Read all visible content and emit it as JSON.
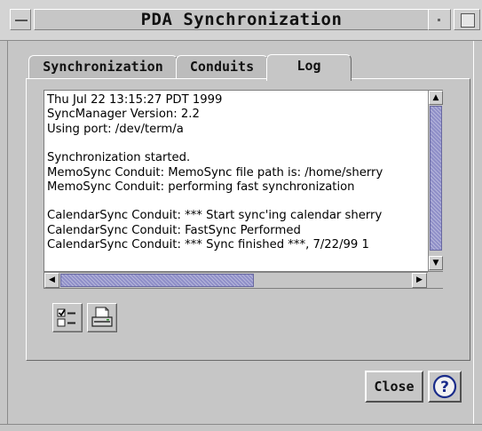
{
  "window": {
    "title": "PDA Synchronization"
  },
  "tabs": [
    {
      "label": "Synchronization",
      "selected": false
    },
    {
      "label": "Conduits",
      "selected": false
    },
    {
      "label": "Log",
      "selected": true
    }
  ],
  "log": {
    "lines": [
      "Thu Jul 22 13:15:27 PDT 1999",
      "SyncManager Version: 2.2",
      "Using port: /dev/term/a",
      "",
      "Synchronization started.",
      "MemoSync Conduit: MemoSync file path is: /home/sherry",
      "MemoSync Conduit: performing fast synchronization",
      "",
      "CalendarSync Conduit: *** Start sync'ing calendar sherry",
      "CalendarSync Conduit: FastSync Performed",
      "CalendarSync Conduit: *** Sync finished ***, 7/22/99 1"
    ]
  },
  "toolbar": {
    "select_all_icon": "select-all-icon",
    "print_icon": "printer-icon"
  },
  "buttons": {
    "close_label": "Close",
    "help_icon": "help-question-icon"
  },
  "colors": {
    "background": "#c6c6c6",
    "scroll_thumb": "#8f8fc8",
    "help_ring": "#1a2c8a"
  }
}
